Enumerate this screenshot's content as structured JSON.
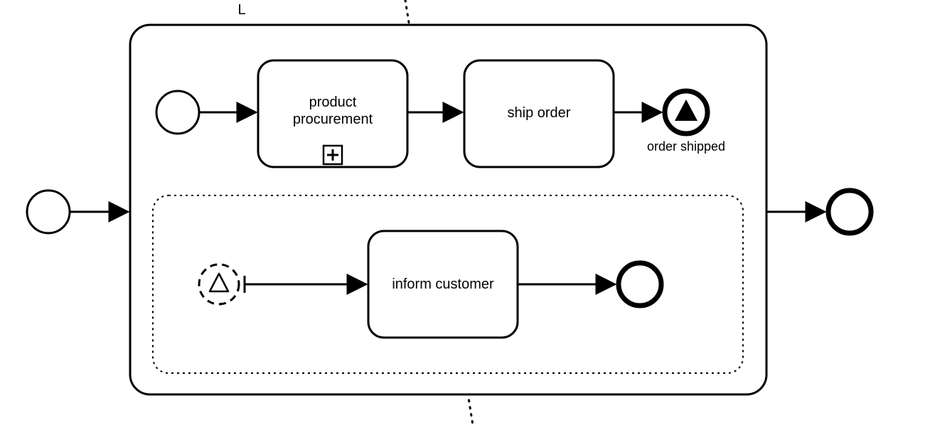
{
  "chart_data": {
    "type": "bpmn-diagram",
    "title": "",
    "elements": {
      "outer_start": {
        "kind": "start-event"
      },
      "outer_end": {
        "kind": "end-event"
      },
      "subprocess": {
        "kind": "expanded-subprocess"
      },
      "inner_start": {
        "kind": "start-event"
      },
      "task_product_procurement": {
        "kind": "call-activity",
        "marker": "collapsed-subprocess"
      },
      "task_ship_order": {
        "kind": "task"
      },
      "signal_throw_end": {
        "kind": "signal-end-event",
        "label": "order shipped"
      },
      "event_subprocess": {
        "kind": "event-subprocess"
      },
      "signal_catch_start": {
        "kind": "signal-start-event",
        "interrupting": false
      },
      "task_inform_customer": {
        "kind": "task"
      },
      "inner_end2": {
        "kind": "end-event"
      }
    },
    "flows": [
      [
        "outer_start",
        "subprocess"
      ],
      [
        "subprocess",
        "outer_end"
      ],
      [
        "inner_start",
        "task_product_procurement"
      ],
      [
        "task_product_procurement",
        "task_ship_order"
      ],
      [
        "task_ship_order",
        "signal_throw_end"
      ],
      [
        "signal_catch_start",
        "task_inform_customer"
      ],
      [
        "task_inform_customer",
        "inner_end2"
      ]
    ]
  },
  "labels": {
    "product_procurement_l1": "product",
    "product_procurement_l2": "procurement",
    "ship_order": "ship order",
    "order_shipped": "order shipped",
    "inform_customer": "inform customer",
    "stray_L": "L"
  }
}
